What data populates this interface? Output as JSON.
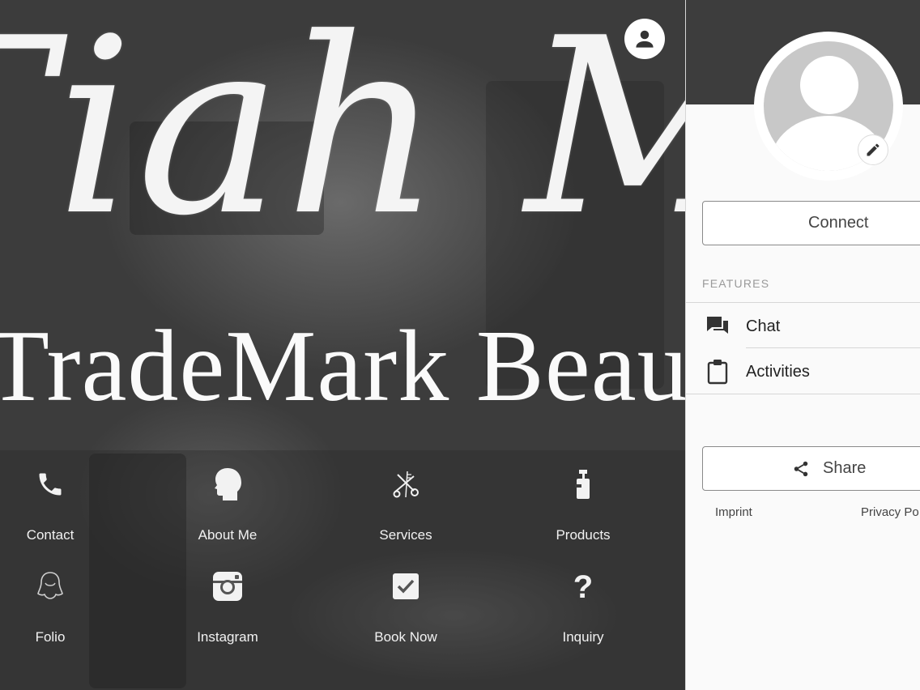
{
  "header": {
    "script_name": "Tiah Mari",
    "tagline": "TradeMark Beauty"
  },
  "menu": [
    {
      "label": "Contact",
      "icon": "phone-icon"
    },
    {
      "label": "About Me",
      "icon": "head-silhouette-icon"
    },
    {
      "label": "Services",
      "icon": "scissors-comb-icon"
    },
    {
      "label": "Products",
      "icon": "pump-bottle-icon"
    },
    {
      "label": "Folio",
      "icon": "woman-hair-icon"
    },
    {
      "label": "Instagram",
      "icon": "instagram-icon"
    },
    {
      "label": "Book Now",
      "icon": "checkbox-icon"
    },
    {
      "label": "Inquiry",
      "icon": "question-mark-icon"
    }
  ],
  "panel": {
    "connect_label": "Connect",
    "features_heading": "FEATURES",
    "features": [
      {
        "label": "Chat",
        "icon": "chat-bubbles-icon"
      },
      {
        "label": "Activities",
        "icon": "clipboard-icon"
      }
    ],
    "share_label": "Share",
    "imprint_label": "Imprint",
    "privacy_label": "Privacy Po"
  },
  "colors": {
    "panel_dark": "#3d3d3d",
    "panel_light": "#fafafa",
    "avatar_gray": "#c8c8c8"
  }
}
